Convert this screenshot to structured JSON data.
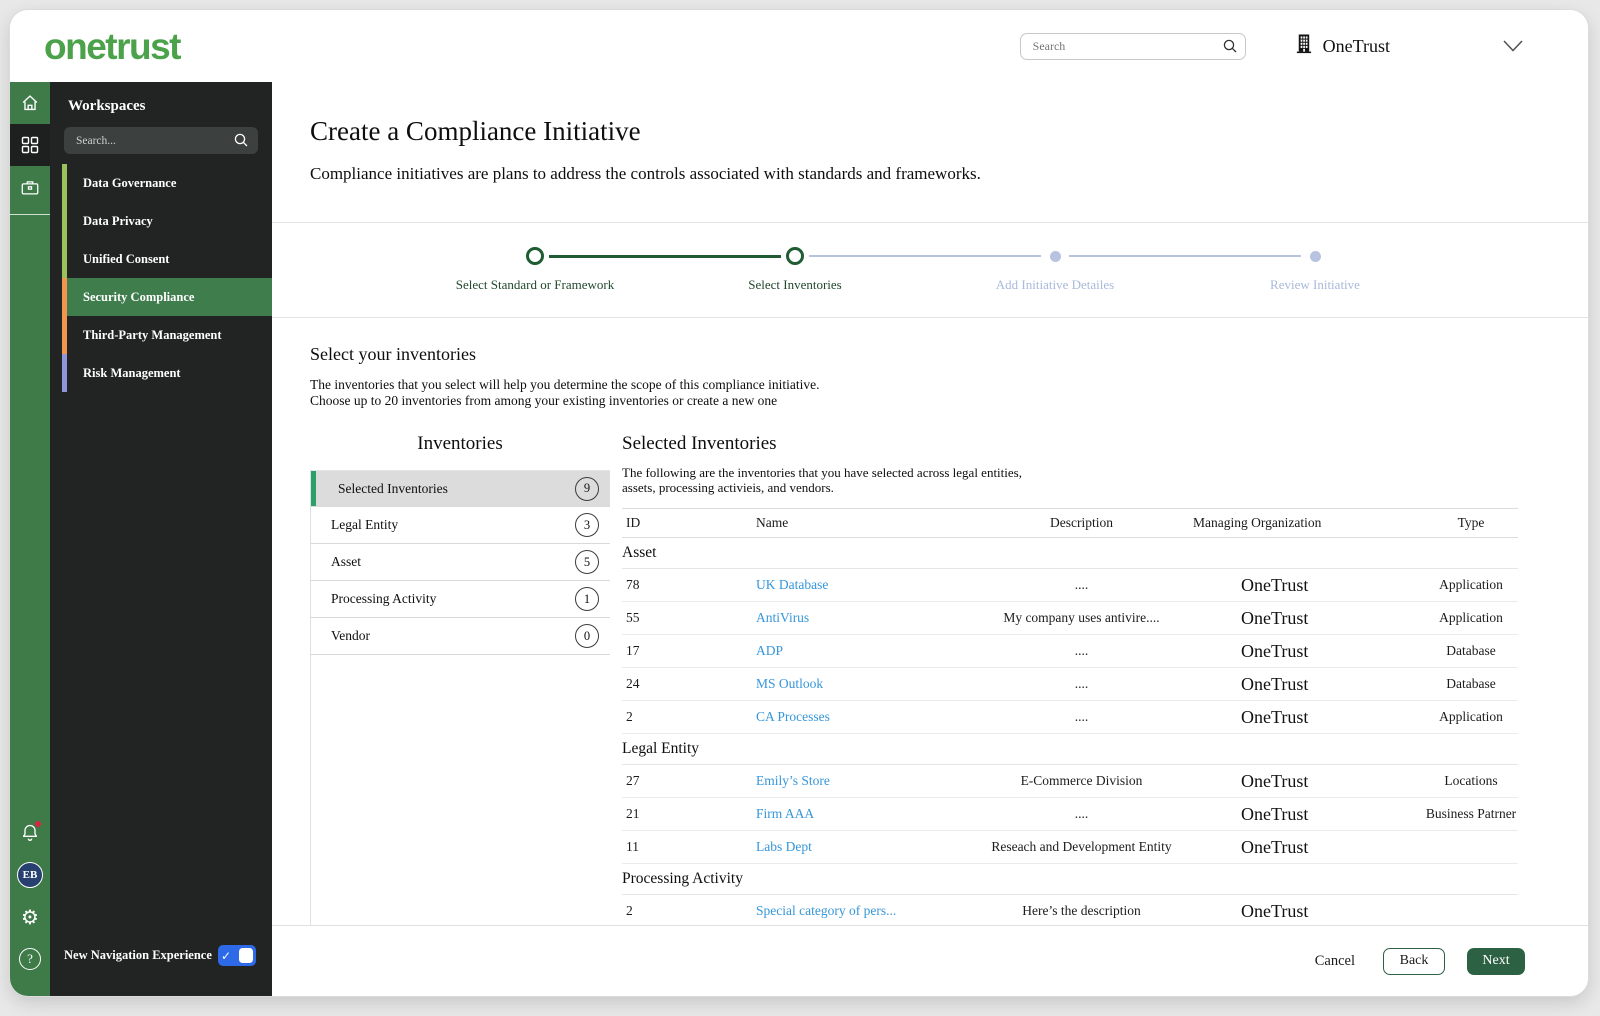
{
  "header": {
    "logo": "onetrust",
    "search_placeholder": "Search",
    "org_name": "OneTrust"
  },
  "sidebar": {
    "workspaces_title": "Workspaces",
    "search_placeholder": "Search...",
    "items": [
      {
        "label": "Data Governance",
        "strip": "#9dc05f",
        "active": false
      },
      {
        "label": "Data Privacy",
        "strip": "#9dc05f",
        "active": false
      },
      {
        "label": "Unified Consent",
        "strip": "#9dc05f",
        "active": false
      },
      {
        "label": "Security Compliance",
        "strip": "#f2964f",
        "active": true
      },
      {
        "label": "Third-Party Management",
        "strip": "#f2964f",
        "active": false
      },
      {
        "label": "Risk Management",
        "strip": "#8f97d8",
        "active": false
      }
    ],
    "footer_toggle_label": "New Navigation Experience",
    "toggle_on": true,
    "avatar_initials": "EB"
  },
  "page": {
    "title": "Create a Compliance Initiative",
    "subtitle": "Compliance initiatives are plans to address the controls associated with standards and frameworks."
  },
  "stepper": {
    "steps": [
      {
        "label": "Select Standard or Framework",
        "state": "complete"
      },
      {
        "label": "Select Inventories",
        "state": "current"
      },
      {
        "label": "Add Initiative Detailes",
        "state": "upcoming"
      },
      {
        "label": "Review Initiative",
        "state": "upcoming"
      }
    ]
  },
  "section": {
    "title": "Select your inventories",
    "description_line1": "The inventories that you select will help you determine the scope of this compliance initiative.",
    "description_line2": "Choose up to 20 inventories from among your existing inventories or create a new one"
  },
  "inventories": {
    "title": "Inventories",
    "items": [
      {
        "label": "Selected Inventories",
        "count": "9",
        "selected": true
      },
      {
        "label": "Legal Entity",
        "count": "3",
        "selected": false
      },
      {
        "label": "Asset",
        "count": "5",
        "selected": false
      },
      {
        "label": "Processing Activity",
        "count": "1",
        "selected": false
      },
      {
        "label": "Vendor",
        "count": "0",
        "selected": false
      }
    ]
  },
  "selected_inventories": {
    "title": "Selected Inventories",
    "description_line1": "The following are the inventories that you have selected across legal entities,",
    "description_line2": "assets, processing activieis, and vendors.",
    "columns": [
      "ID",
      "Name",
      "Description",
      "Managing Organization",
      "Type"
    ],
    "groups": [
      {
        "name": "Asset",
        "rows": [
          {
            "id": "78",
            "name": "UK Database",
            "description": "....",
            "org": "OneTrust",
            "type": "Application"
          },
          {
            "id": "55",
            "name": "AntiVirus",
            "description": "My company uses antivire....",
            "org": "OneTrust",
            "type": "Application"
          },
          {
            "id": "17",
            "name": "ADP",
            "description": "....",
            "org": "OneTrust",
            "type": "Database"
          },
          {
            "id": "24",
            "name": "MS Outlook",
            "description": "....",
            "org": "OneTrust",
            "type": "Database"
          },
          {
            "id": "2",
            "name": "CA Processes",
            "description": "....",
            "org": "OneTrust",
            "type": "Application"
          }
        ]
      },
      {
        "name": "Legal Entity",
        "rows": [
          {
            "id": "27",
            "name": "Emily’s Store",
            "description": "E-Commerce Division",
            "org": "OneTrust",
            "type": "Locations"
          },
          {
            "id": "21",
            "name": "Firm AAA",
            "description": "....",
            "org": "OneTrust",
            "type": "Business Patrner"
          },
          {
            "id": "11",
            "name": "Labs Dept",
            "description": "Reseach and Development Entity",
            "org": "OneTrust",
            "type": ""
          }
        ]
      },
      {
        "name": "Processing Activity",
        "rows": [
          {
            "id": "2",
            "name": "Special category of pers...",
            "description": "Here’s the description",
            "org": "OneTrust",
            "type": ""
          }
        ]
      }
    ]
  },
  "footer": {
    "cancel": "Cancel",
    "back": "Back",
    "next": "Next"
  },
  "colors": {
    "brand_green": "#4ca24b",
    "rail_green": "#3e7b49",
    "active_workspace_green": "#3f7d4c",
    "panel_dark": "#212422",
    "stepper_green": "#1f5c33",
    "stepper_inactive": "#b7c3df",
    "link_blue": "#3696d9",
    "toggle_blue": "#2e6ae8",
    "selected_bar_green": "#2ba06a",
    "next_button_green": "#2c6144",
    "notification_dot_red": "#d9253d"
  }
}
